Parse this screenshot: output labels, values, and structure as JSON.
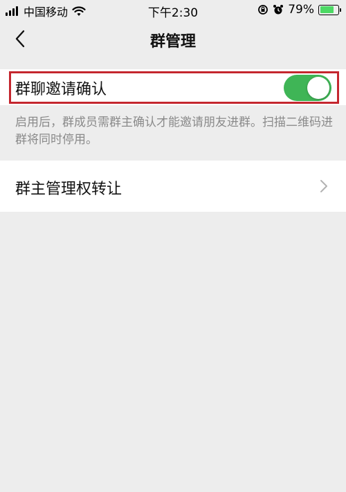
{
  "status_bar": {
    "carrier": "中国移动",
    "time": "下午2:30",
    "battery_text": "79%",
    "battery_level": 0.79,
    "icons": [
      "signal-icon",
      "wifi-icon",
      "rotation-lock-icon",
      "alarm-icon",
      "battery-charging-icon"
    ]
  },
  "nav": {
    "title": "群管理",
    "back_icon": "chevron-left-icon"
  },
  "settings": {
    "invite_confirm": {
      "label": "群聊邀请确认",
      "enabled": true,
      "description": "启用后，群成员需群主确认才能邀请朋友进群。扫描二维码进群将同时停用。"
    },
    "transfer_owner": {
      "label": "群主管理权转让",
      "icon": "chevron-right-icon"
    }
  },
  "colors": {
    "toggle_on": "#3fb556",
    "highlight_border": "#c4262e",
    "background": "#ededed"
  }
}
